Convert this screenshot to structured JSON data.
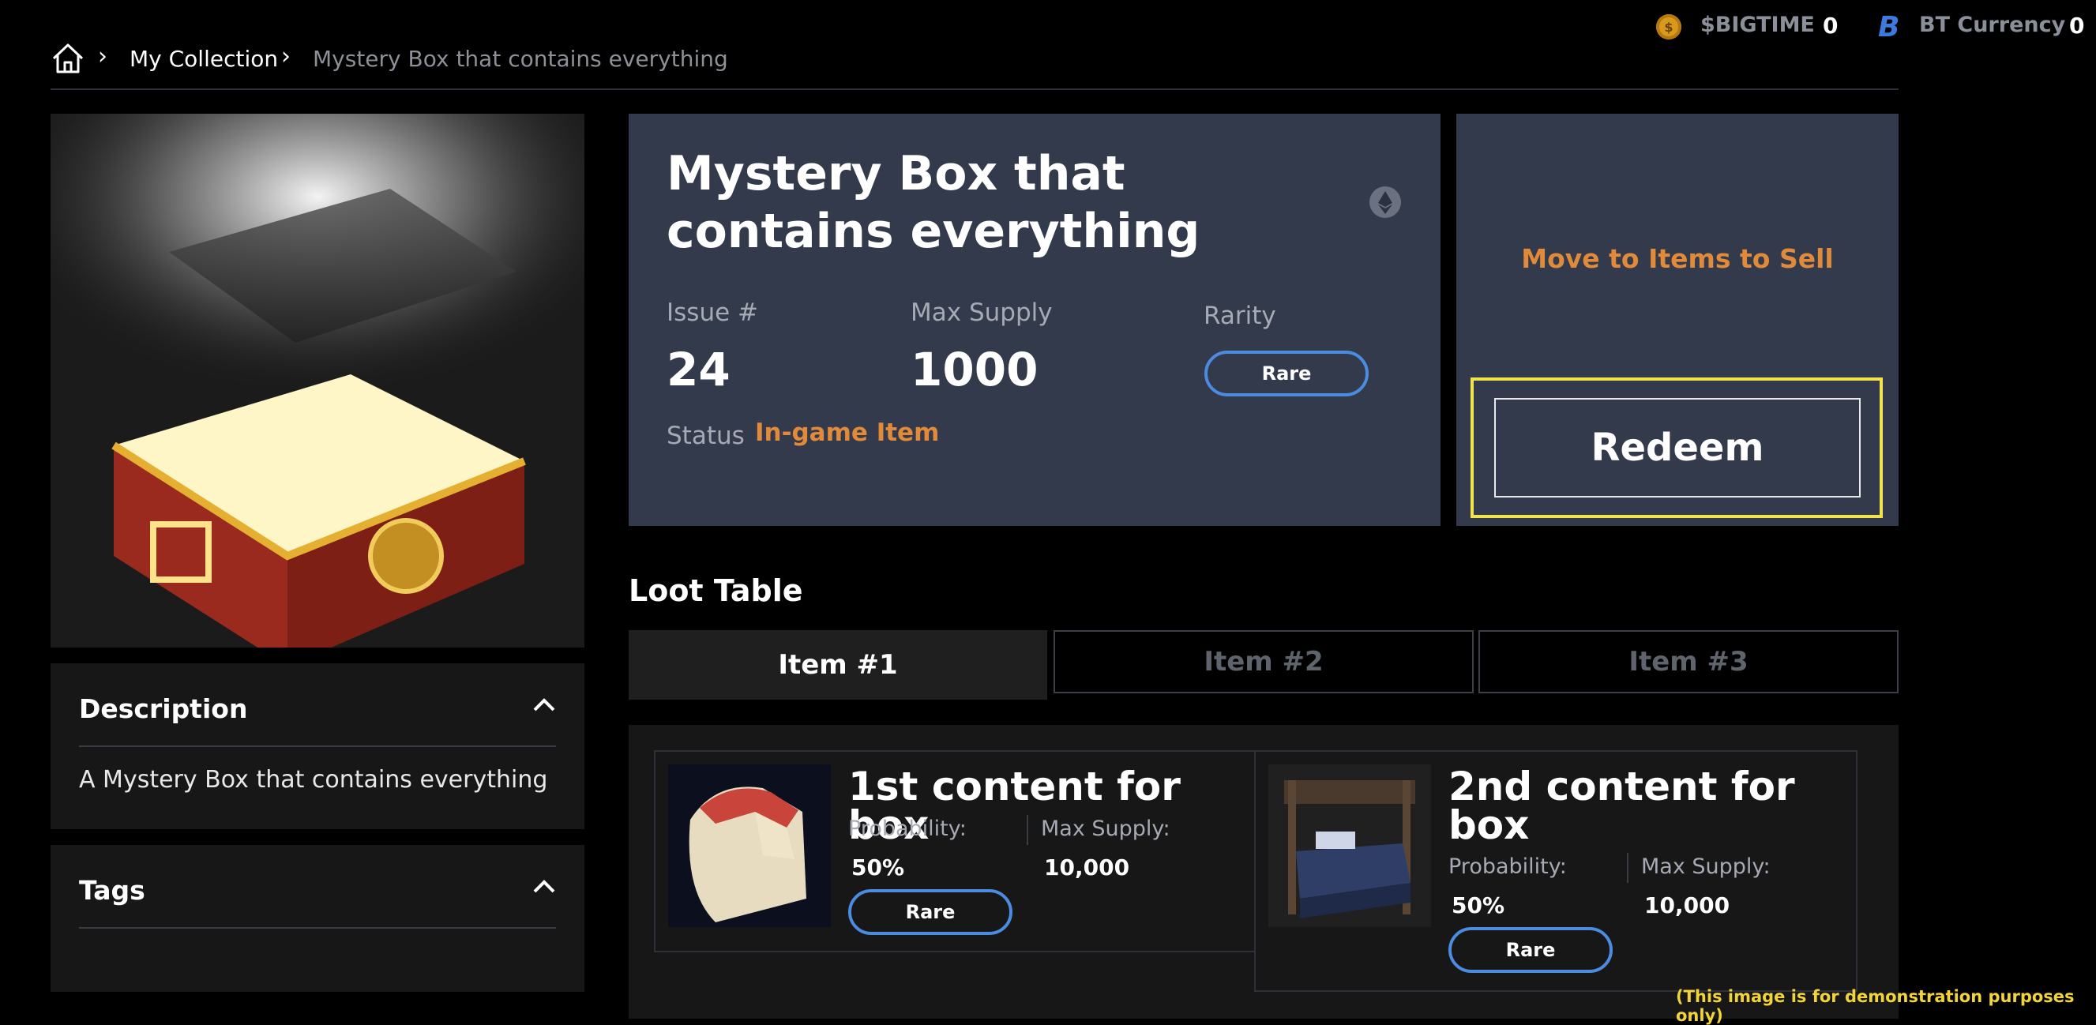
{
  "header": {
    "currencies": [
      {
        "icon": "bigtime-coin-icon",
        "label": "$BIGTIME",
        "value": "0"
      },
      {
        "icon": "bt-currency-icon",
        "label": "BT Currency",
        "value": "0"
      }
    ],
    "breadcrumb": {
      "home_icon": "home-icon",
      "items": [
        "My Collection",
        "Mystery Box that contains everything"
      ]
    }
  },
  "item": {
    "title": "Mystery Box that contains everything",
    "chain_icon": "ethereum-icon",
    "issue_label": "Issue #",
    "issue_value": "24",
    "max_supply_label": "Max Supply",
    "max_supply_value": "1000",
    "rarity_label": "Rarity",
    "rarity_value": "Rare",
    "status_label": "Status",
    "status_value": "In-game Item"
  },
  "actions": {
    "move_label": "Move to Items to Sell",
    "redeem_label": "Redeem"
  },
  "description": {
    "title": "Description",
    "text": "A Mystery Box that contains everything"
  },
  "tags": {
    "title": "Tags"
  },
  "loot": {
    "title": "Loot Table",
    "tabs": [
      "Item #1",
      "Item #2",
      "Item #3"
    ],
    "active_tab": "Item #1",
    "contents": [
      {
        "title": "1st content for box",
        "probability_label": "Probability:",
        "probability": "50%",
        "max_supply_label": "Max Supply:",
        "max_supply": "10,000",
        "rarity": "Rare"
      },
      {
        "title_line1": "2nd content for",
        "title_line2": "box",
        "probability_label": "Probability:",
        "probability": "50%",
        "max_supply_label": "Max Supply:",
        "max_supply": "10,000",
        "rarity": "Rare"
      }
    ]
  },
  "footer_note": "(This image is for demonstration purposes only)",
  "colors": {
    "accent_orange": "#e08a3a",
    "pill_blue": "#4b8be0",
    "highlight_yellow": "#f2e24c",
    "panel_bg": "#333a4b"
  }
}
